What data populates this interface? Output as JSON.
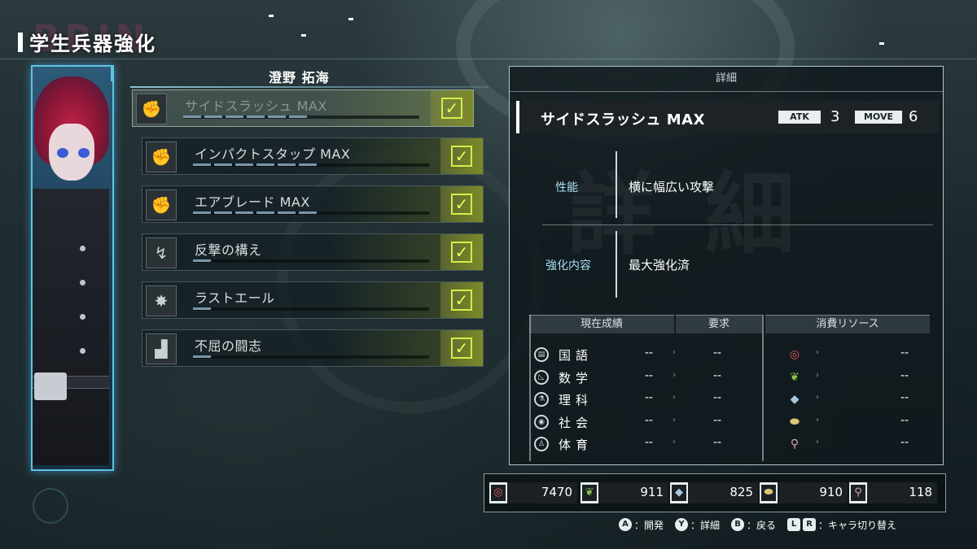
{
  "screen": {
    "title": "学生兵器強化",
    "bg_mark": "BRIN"
  },
  "character": {
    "name": "澄野 拓海"
  },
  "skills": [
    {
      "name": "サイドスラッシュ MAX",
      "icon": "fist-icon",
      "bars": 6,
      "checked": true,
      "selected": true
    },
    {
      "name": "インパクトスタップ MAX",
      "icon": "fist-icon",
      "bars": 6,
      "checked": true,
      "selected": false
    },
    {
      "name": "エアブレード MAX",
      "icon": "fist-icon",
      "bars": 6,
      "checked": true,
      "selected": false
    },
    {
      "name": "反撃の構え",
      "icon": "counter-icon",
      "bars": 1,
      "checked": true,
      "selected": false
    },
    {
      "name": "ラストエール",
      "icon": "burst-icon",
      "bars": 1,
      "checked": true,
      "selected": false
    },
    {
      "name": "不屈の闘志",
      "icon": "tower-icon",
      "bars": 1,
      "checked": true,
      "selected": false
    }
  ],
  "detail": {
    "header": "詳細",
    "watermark": "詳細",
    "skill_name": "サイドスラッシュ MAX",
    "atk_label": "ATK",
    "atk_value": "3",
    "move_label": "MOVE",
    "move_value": "6",
    "perf_label": "性能",
    "perf_value": "横に幅広い攻撃",
    "upgrade_label": "強化内容",
    "upgrade_value": "最大強化済",
    "col_current": "現在成績",
    "col_required": "要求",
    "col_resources": "消費リソース",
    "subjects": [
      {
        "name": "国語",
        "icon": "book-icon",
        "current": "--",
        "required": "--",
        "res_icon": "coin-icon",
        "res_color": "#e05a5a",
        "resource": "--"
      },
      {
        "name": "数学",
        "icon": "triangle-ruler-icon",
        "current": "--",
        "required": "--",
        "res_icon": "leaf-icon",
        "res_color": "#8cc84a",
        "resource": "--"
      },
      {
        "name": "理科",
        "icon": "flask-icon",
        "current": "--",
        "required": "--",
        "res_icon": "crystal-icon",
        "res_color": "#a8c8e0",
        "resource": "--"
      },
      {
        "name": "社会",
        "icon": "globe-icon",
        "current": "--",
        "required": "--",
        "res_icon": "ore-icon",
        "res_color": "#d8c870",
        "resource": "--"
      },
      {
        "name": "体育",
        "icon": "runner-icon",
        "current": "--",
        "required": "--",
        "res_icon": "key-icon",
        "res_color": "#e0a0c0",
        "resource": "--"
      }
    ]
  },
  "resources": [
    {
      "icon": "coin-icon",
      "color": "#e05a5a",
      "value": "7470"
    },
    {
      "icon": "leaf-icon",
      "color": "#8cc84a",
      "value": "911"
    },
    {
      "icon": "crystal-icon",
      "color": "#a8c8e0",
      "value": "825"
    },
    {
      "icon": "ore-icon",
      "color": "#d8c870",
      "value": "910"
    },
    {
      "icon": "key-icon",
      "color": "#e0a0c0",
      "value": "118"
    }
  ],
  "controls": [
    {
      "key": "A",
      "label": "：開発"
    },
    {
      "key": "Y",
      "label": "：詳細"
    },
    {
      "key": "B",
      "label": "：戻る"
    },
    {
      "key": "L",
      "key2": "R",
      "label": "：キャラ切り替え"
    }
  ],
  "colors": {
    "accent_check": "#d8ec4a",
    "frame_blue": "#5ec2e8",
    "label_blue": "#a8dcf0"
  }
}
